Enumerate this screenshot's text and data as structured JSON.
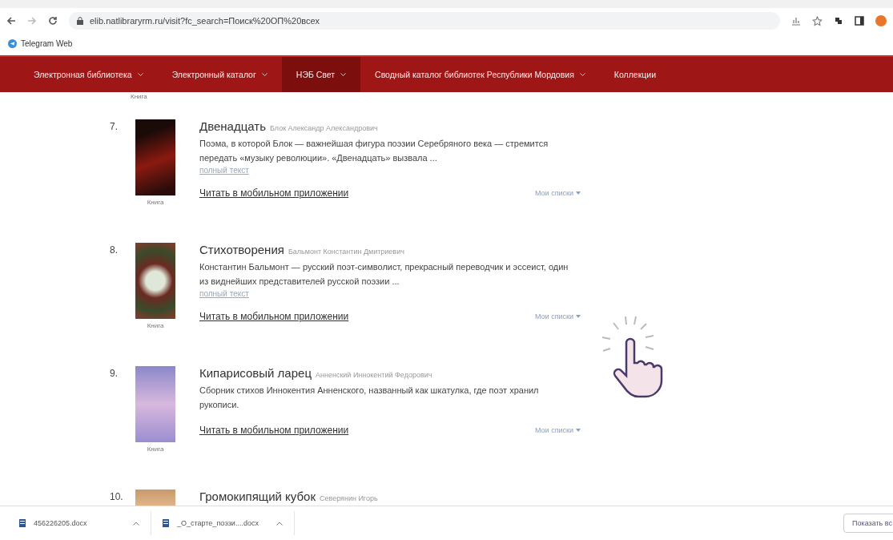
{
  "browser": {
    "url": "elib.natlibraryrm.ru/visit?fc_search=Поиск%20ОП%20всех",
    "bookmarks": [
      {
        "label": "Telegram Web"
      }
    ]
  },
  "nav": [
    {
      "label": "Электронная библиотека",
      "dropdown": true,
      "selected": false
    },
    {
      "label": "Электронный каталог",
      "dropdown": true,
      "selected": false
    },
    {
      "label": "НЭБ Свет",
      "dropdown": true,
      "selected": true
    },
    {
      "label": "Сводный каталог библиотек Республики Мордовия",
      "dropdown": true,
      "selected": false
    },
    {
      "label": "Коллекции",
      "dropdown": false,
      "selected": false
    }
  ],
  "previous_type_label": "Книга",
  "results": [
    {
      "number": "7.",
      "title": "Двенадцать",
      "author": "Блок Александр Александрович",
      "description": "Поэма, в которой Блок — важнейшая фигура поэзии Серебряного века — стремится передать «музыку революции». «Двенадцать» вызвала ...",
      "full_text_link": "полный текст",
      "type_label": "Книга",
      "read_link": "Читать в мобильном приложении",
      "lists_button": "Мои списки"
    },
    {
      "number": "8.",
      "title": "Стихотворения",
      "author": "Бальмонт Константин Дмитриевич",
      "description": "Константин Бальмонт — русский поэт-символист, прекрасный переводчик и эссеист, один из виднейших представителей русской поэзии ...",
      "full_text_link": "полный текст",
      "type_label": "Книга",
      "read_link": "Читать в мобильном приложении",
      "lists_button": "Мои списки"
    },
    {
      "number": "9.",
      "title": "Кипарисовый ларец",
      "author": "Анненский Иннокентий Федорович",
      "description": "Сборник стихов Иннокентия Анненского, названный как шкатулка, где поэт хранил рукописи.",
      "type_label": "Книга",
      "read_link": "Читать в мобильном приложении",
      "lists_button": "Мои списки"
    },
    {
      "number": "10.",
      "title": "Громокипящий кубок",
      "author": "Северянин Игорь"
    }
  ],
  "downloads": [
    {
      "file": "456226205.docx"
    },
    {
      "file": "_О_старте_поэзи....docx"
    }
  ],
  "show_all": "Показать вс"
}
